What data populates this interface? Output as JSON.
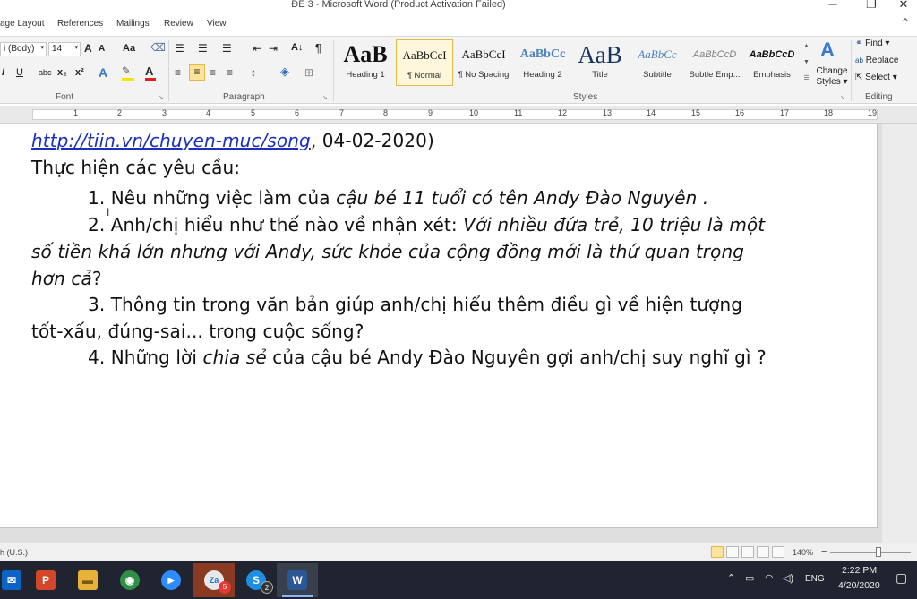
{
  "window": {
    "title": "ĐỀ 3  -  Microsoft Word (Product Activation Failed)",
    "minimize": "─",
    "restore": "❐",
    "close": "✕"
  },
  "tabs": [
    "age Layout",
    "References",
    "Mailings",
    "Review",
    "View"
  ],
  "ribbon": {
    "font": {
      "name": "i (Body)",
      "size": "14",
      "grow": "A",
      "shrink": "A",
      "case": "Aa",
      "italic": "I",
      "underline": "U",
      "strike": "abc",
      "subscript": "x₂",
      "superscript": "x²",
      "label": "Font"
    },
    "paragraph": {
      "sort": "A↓",
      "pilcrow": "¶",
      "label": "Paragraph"
    },
    "styles": {
      "label": "Styles",
      "items": [
        {
          "sample": "AaB",
          "name": "Heading 1"
        },
        {
          "sample": "AaBbCcI",
          "name": "¶ Normal"
        },
        {
          "sample": "AaBbCcI",
          "name": "¶ No Spacing"
        },
        {
          "sample": "AaBbCc",
          "name": "Heading 2"
        },
        {
          "sample": "AaB",
          "name": "Title"
        },
        {
          "sample": "AaBbCc",
          "name": "Subtitle"
        },
        {
          "sample": "AaBbCcD",
          "name": "Subtle Emp..."
        },
        {
          "sample": "AaBbCcD",
          "name": "Emphasis"
        }
      ],
      "change_styles": "Change Styles ▾"
    },
    "editing": {
      "find": "Find ▾",
      "replace": "Replace",
      "select": "Select ▾",
      "label": "Editing"
    }
  },
  "ruler": {
    "numbers": [
      "1",
      "2",
      "3",
      "4",
      "5",
      "6",
      "7",
      "8",
      "9",
      "10",
      "11",
      "12",
      "13",
      "14",
      "15",
      "16",
      "17",
      "18",
      "19"
    ]
  },
  "document": {
    "line1_link": "http://tiin.vn/chuyen-muc/song",
    "line1_rest": ", 04-02-2020)",
    "line2": "Thực hiện các yêu cầu:",
    "q1_a": "1. Nêu những việc làm của ",
    "q1_b": "cậu bé 11 tuổi có tên Andy Đào Nguyên .",
    "q2_a": "2. Anh/chị hiểu như thế nào về nhận xét: ",
    "q2_b": "Với nhiều đứa trẻ, 10 triệu là một",
    "q2_c": "số tiền khá lớn nhưng với Andy, sức khỏe của cộng đồng mới là thứ quan trọng",
    "q2_d": "hơn cả",
    "q2_e": "?",
    "q3_a": "3. Thông tin trong văn bản giúp anh/chị hiểu thêm điều gì về hiện tượng",
    "q3_b": "tốt-xấu, đúng-sai... trong cuộc sống?",
    "q4_a": "4. Những lời ",
    "q4_b": "chia sẻ",
    "q4_c": " của cậu bé Andy Đào Nguyên gợi anh/chị suy nghĩ gì ?"
  },
  "statusbar": {
    "language": "h (U.S.)",
    "zoom": "140%",
    "zoom_minus": "−"
  },
  "taskbar": {
    "apps": [
      {
        "name": "mail",
        "glyph": "✉",
        "color": "#0a64c8"
      },
      {
        "name": "powerpoint",
        "glyph": "P",
        "color": "#d2472a"
      },
      {
        "name": "file-explorer",
        "glyph": "▬",
        "color": "#e8b23a"
      },
      {
        "name": "coccoc-browser",
        "glyph": "◉",
        "color": "#3a9a3a"
      },
      {
        "name": "zoom",
        "glyph": "▶",
        "color": "#2d8cff"
      },
      {
        "name": "zalo",
        "glyph": "Za",
        "color": "#e8e8e8",
        "badge": "5"
      },
      {
        "name": "skype",
        "glyph": "S",
        "color": "#1e8fe0",
        "badge": "2"
      },
      {
        "name": "word",
        "glyph": "W",
        "color": "#2b5797"
      }
    ],
    "tray": {
      "lang": "ENG",
      "time": "2:22 PM",
      "date": "4/20/2020",
      "chevron": "⌃"
    }
  }
}
